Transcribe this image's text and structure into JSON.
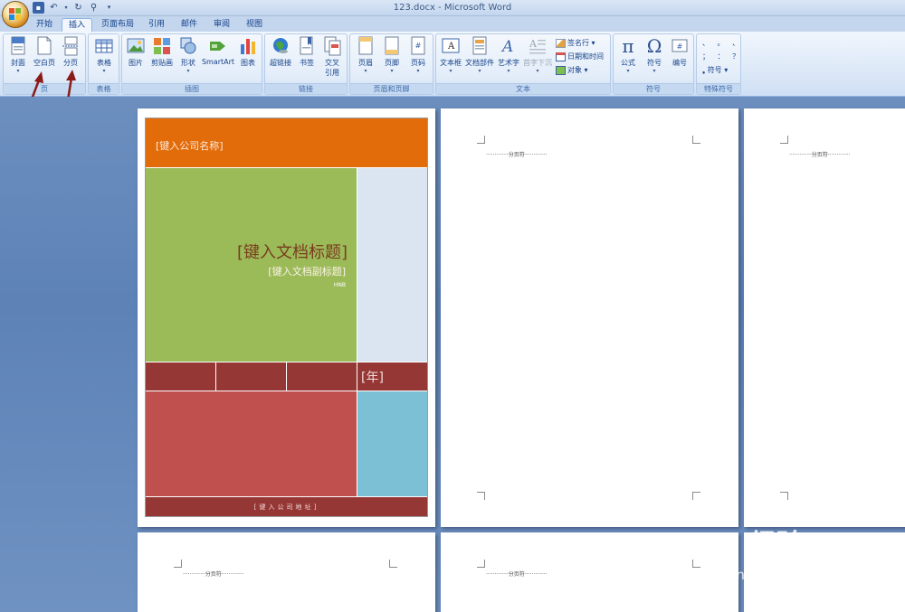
{
  "window": {
    "title": "123.docx - Microsoft Word"
  },
  "tabs": [
    {
      "label": "开始"
    },
    {
      "label": "插入"
    },
    {
      "label": "页面布局"
    },
    {
      "label": "引用"
    },
    {
      "label": "邮件"
    },
    {
      "label": "审阅"
    },
    {
      "label": "视图"
    }
  ],
  "ribbon": {
    "groups": {
      "page": {
        "label": "页",
        "cover": "封面",
        "blank": "空白页",
        "break": "分页"
      },
      "table": {
        "label": "表格",
        "table": "表格"
      },
      "illus": {
        "label": "插图",
        "picture": "图片",
        "clipart": "剪贴画",
        "shapes": "形状",
        "smartart": "SmartArt",
        "chart": "图表"
      },
      "links": {
        "label": "链接",
        "hyperlink": "超链接",
        "bookmark": "书签",
        "crossref_1": "交叉",
        "crossref_2": "引用"
      },
      "hf": {
        "label": "页眉和页脚",
        "header": "页眉",
        "footer": "页脚",
        "pagenum": "页码"
      },
      "text": {
        "label": "文本",
        "textbox": "文本框",
        "parts": "文档部件",
        "wordart": "艺术字",
        "dropcap": "首字下沉",
        "signature": "签名行",
        "datetime": "日期和时间",
        "object": "对象"
      },
      "symbols": {
        "label": "符号",
        "equation": "公式",
        "symbol": "符号",
        "number": "编号"
      },
      "special": {
        "label": "特殊符号",
        "r1": "、 。 、",
        "r2": "； ： ？",
        "symbol": "符号"
      }
    }
  },
  "cover": {
    "company": "[键入公司名称]",
    "title": "[键入文档标题]",
    "subtitle": "[键入文档副标题]",
    "author": "HNB",
    "year": "[年]",
    "address": "[键入公司地址]",
    "colors": {
      "orange": "#e36c0a",
      "green": "#9bbb59",
      "lightblue": "#dbe5f1",
      "darkred": "#953734",
      "red": "#c0504d",
      "teal": "#7cc0d6"
    }
  },
  "page_break_text": "分页符",
  "watermark": {
    "brand": "Bai 经验",
    "url": "jingyan.baidu.com"
  }
}
